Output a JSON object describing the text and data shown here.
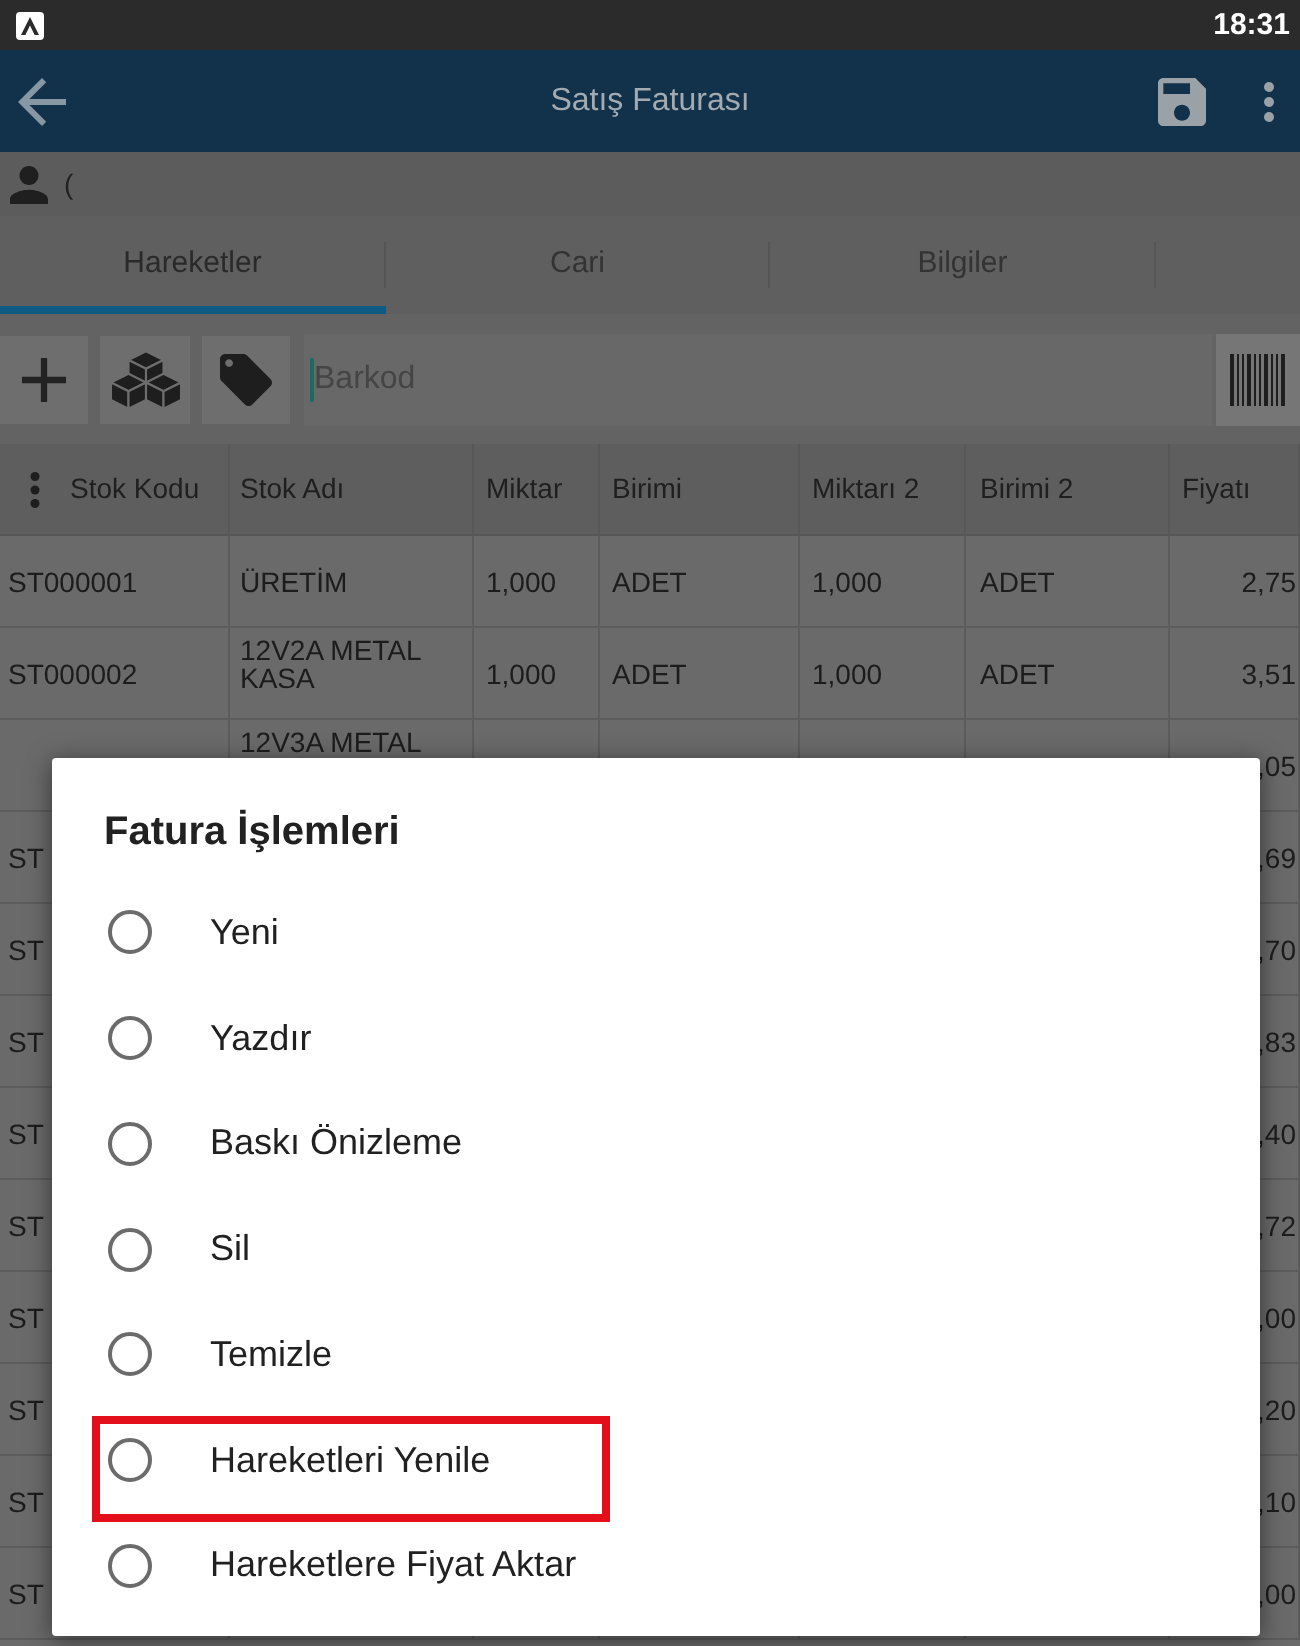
{
  "status_bar": {
    "time": "18:31"
  },
  "app_bar": {
    "title": "Satış Faturası"
  },
  "customer": {
    "name": "("
  },
  "tabs": [
    {
      "label": "Hareketler",
      "selected": true
    },
    {
      "label": "Cari",
      "selected": false
    },
    {
      "label": "Bilgiler",
      "selected": false
    }
  ],
  "barcode_field": {
    "placeholder": "Barkod"
  },
  "table": {
    "columns": [
      "Stok Kodu",
      "Stok Adı",
      "Miktar",
      "Birimi",
      "Miktarı 2",
      "Birimi 2",
      "Fiyatı"
    ],
    "rows": [
      {
        "cells": [
          "ST000001",
          "ÜRETİM",
          "1,000",
          "ADET",
          "1,000",
          "ADET",
          "2,75"
        ],
        "name_wrapped": false
      },
      {
        "cells": [
          "ST000002",
          "12V2A METAL KASA",
          "1,000",
          "ADET",
          "1,000",
          "ADET",
          "3,51"
        ],
        "name_wrapped": true
      },
      {
        "cells": [
          null,
          "12V3A METAL",
          null,
          null,
          null,
          null,
          ",05"
        ],
        "name_wrapped": true
      },
      {
        "cells": [
          "ST",
          null,
          null,
          null,
          null,
          null,
          ",69"
        ],
        "name_wrapped": false
      },
      {
        "cells": [
          "ST",
          null,
          null,
          null,
          null,
          null,
          ",70"
        ],
        "name_wrapped": false
      },
      {
        "cells": [
          "ST",
          null,
          null,
          null,
          null,
          null,
          ",83"
        ],
        "name_wrapped": false
      },
      {
        "cells": [
          "ST",
          null,
          null,
          null,
          null,
          null,
          ",40"
        ],
        "name_wrapped": false
      },
      {
        "cells": [
          "ST",
          null,
          null,
          null,
          null,
          null,
          ",72"
        ],
        "name_wrapped": false
      },
      {
        "cells": [
          "ST",
          null,
          null,
          null,
          null,
          null,
          ",00"
        ],
        "name_wrapped": false
      },
      {
        "cells": [
          "ST",
          null,
          null,
          null,
          null,
          null,
          ",20"
        ],
        "name_wrapped": false
      },
      {
        "cells": [
          "ST",
          null,
          null,
          null,
          null,
          null,
          ",10"
        ],
        "name_wrapped": false
      },
      {
        "cells": [
          "ST",
          null,
          null,
          null,
          null,
          null,
          ",00"
        ],
        "name_wrapped": false
      }
    ]
  },
  "dialog": {
    "title": "Fatura İşlemleri",
    "options": [
      {
        "label": "Yeni",
        "selected": false,
        "highlighted": false
      },
      {
        "label": "Yazdır",
        "selected": false,
        "highlighted": false
      },
      {
        "label": "Baskı Önizleme",
        "selected": false,
        "highlighted": false
      },
      {
        "label": "Sil",
        "selected": false,
        "highlighted": false
      },
      {
        "label": "Temizle",
        "selected": false,
        "highlighted": false
      },
      {
        "label": "Hareketleri Yenile",
        "selected": false,
        "highlighted": true
      },
      {
        "label": "Hareketlere Fiyat Aktar",
        "selected": false,
        "highlighted": false
      }
    ]
  }
}
